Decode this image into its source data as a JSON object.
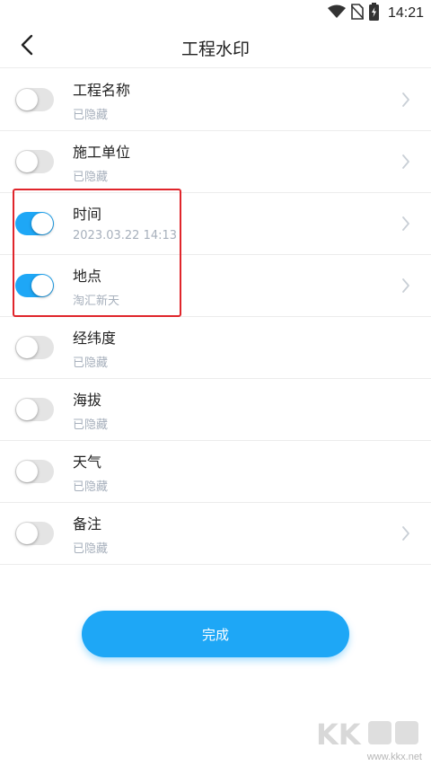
{
  "status_bar": {
    "time": "14:21"
  },
  "header": {
    "title": "工程水印"
  },
  "items": [
    {
      "label": "工程名称",
      "sub": "已隐藏",
      "on": false,
      "chevron": true
    },
    {
      "label": "施工单位",
      "sub": "已隐藏",
      "on": false,
      "chevron": true
    },
    {
      "label": "时间",
      "sub": "2023.03.22 14:13",
      "on": true,
      "chevron": true
    },
    {
      "label": "地点",
      "sub": "淘汇新天",
      "on": true,
      "chevron": true
    },
    {
      "label": "经纬度",
      "sub": "已隐藏",
      "on": false,
      "chevron": false
    },
    {
      "label": "海拔",
      "sub": "已隐藏",
      "on": false,
      "chevron": false
    },
    {
      "label": "天气",
      "sub": "已隐藏",
      "on": false,
      "chevron": false
    },
    {
      "label": "备注",
      "sub": "已隐藏",
      "on": false,
      "chevron": true
    }
  ],
  "done_button": {
    "label": "完成"
  },
  "watermark": {
    "logo": "KK下载",
    "url": "www.kkx.net"
  },
  "colors": {
    "accent": "#1ea7f6",
    "highlight": "#e0252b"
  },
  "icons": [
    "wifi-icon",
    "no-sim-icon",
    "battery-charging-icon",
    "back-arrow-icon",
    "chevron-right-icon"
  ]
}
